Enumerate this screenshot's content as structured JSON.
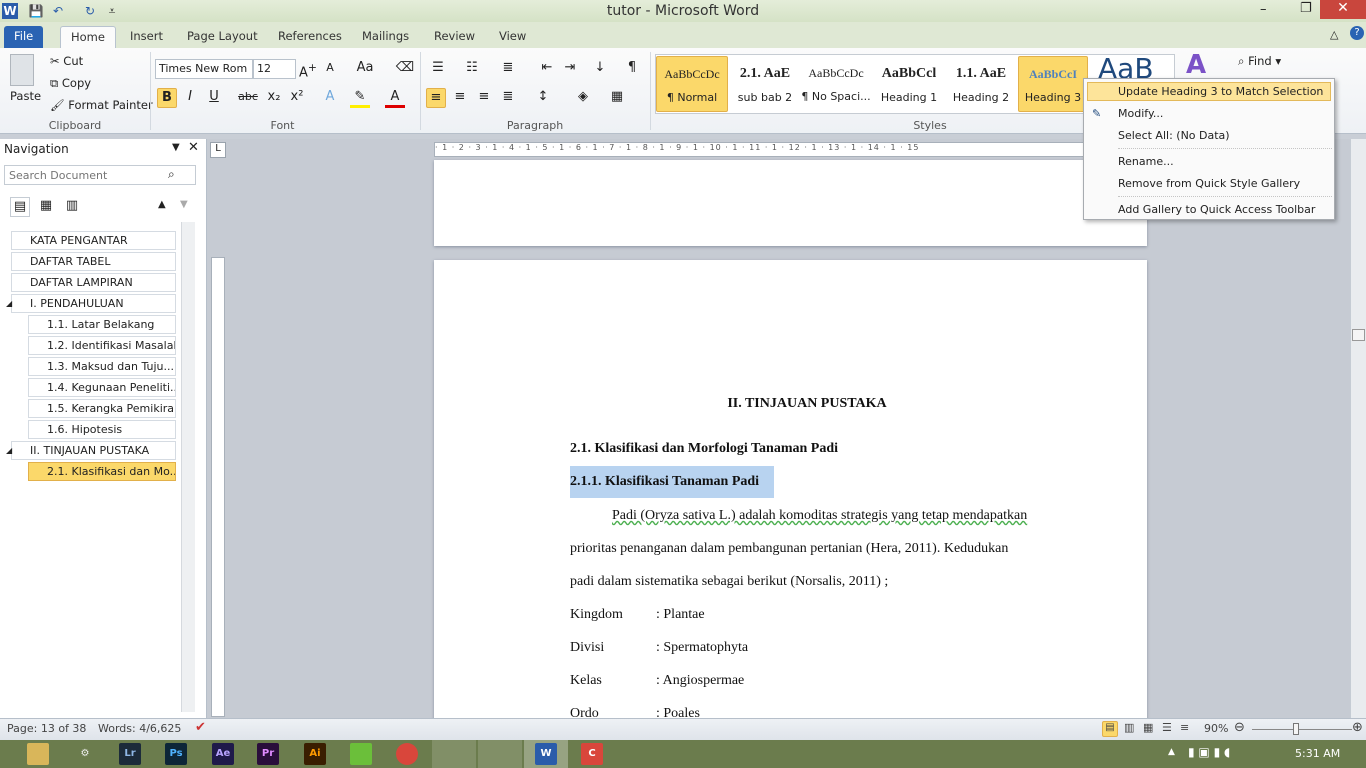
{
  "window": {
    "title": "tutor - Microsoft Word"
  },
  "tabs": [
    "File",
    "Home",
    "Insert",
    "Page Layout",
    "References",
    "Mailings",
    "Review",
    "View"
  ],
  "clipboard": {
    "paste": "Paste",
    "cut": "Cut",
    "copy": "Copy",
    "format_painter": "Format Painter",
    "label": "Clipboard"
  },
  "font": {
    "name": "Times New Rom",
    "size": "12",
    "label": "Font"
  },
  "paragraph": {
    "label": "Paragraph"
  },
  "styles": {
    "label": "Styles",
    "items": [
      {
        "preview": "AaBbCcDc",
        "name": "¶ Normal"
      },
      {
        "preview": "2.1. AaE",
        "name": "sub bab 2"
      },
      {
        "preview": "AaBbCcDc",
        "name": "¶ No Spaci..."
      },
      {
        "preview": "AaBbCcl",
        "name": "Heading 1"
      },
      {
        "preview": "1.1. AaE",
        "name": "Heading 2"
      },
      {
        "preview": "AaBbCcI",
        "name": "Heading 3"
      }
    ],
    "big_preview": "AaB"
  },
  "editing": {
    "find": "Find"
  },
  "context_menu": [
    "Update Heading 3 to Match Selection",
    "Modify...",
    "Select All: (No Data)",
    "Rename...",
    "Remove from Quick Style Gallery",
    "Add Gallery to Quick Access Toolbar"
  ],
  "navigation": {
    "title": "Navigation",
    "search_placeholder": "Search Document",
    "items": [
      {
        "label": "KATA PENGANTAR",
        "level": 1
      },
      {
        "label": "DAFTAR TABEL",
        "level": 1
      },
      {
        "label": "DAFTAR LAMPIRAN",
        "level": 1
      },
      {
        "label": "I. PENDAHULUAN",
        "level": 1
      },
      {
        "label": "1.1.  Latar Belakang",
        "level": 2
      },
      {
        "label": "1.2.  Identifikasi Masalah",
        "level": 2
      },
      {
        "label": "1.3.  Maksud dan Tuju...",
        "level": 2
      },
      {
        "label": "1.4.  Kegunaan Peneliti...",
        "level": 2
      },
      {
        "label": "1.5.  Kerangka Pemikiran",
        "level": 2
      },
      {
        "label": "1.6.  Hipotesis",
        "level": 2
      },
      {
        "label": "II. TINJAUAN PUSTAKA",
        "level": 1
      },
      {
        "label": "2.1.  Klasifikasi dan Mo...",
        "level": 2,
        "selected": true
      }
    ]
  },
  "document": {
    "chapter": "II. TINJAUAN  PUSTAKA",
    "h2": "2.1.  Klasifikasi dan Morfologi Tanaman  Padi",
    "h3": "2.1.1. Klasifikasi Tanaman  Padi",
    "para": [
      "Padi  (Oryza  sativa  L.)  adalah  komoditas  strategis  yang  tetap  mendapatkan",
      "prioritas  penanganan  dalam  pembangunan  pertanian  (Hera,  2011).  Kedudukan",
      "padi dalam  sistematika  sebagai  berikut (Norsalis,  2011) ;"
    ],
    "taxonomy": [
      {
        "k": "Kingdom",
        "v": ": Plantae"
      },
      {
        "k": "Divisi",
        "v": ": Spermatophyta"
      },
      {
        "k": "Kelas",
        "v": ": Angiospermae"
      },
      {
        "k": "Ordo",
        "v": ": Poales"
      }
    ]
  },
  "status": {
    "page": "Page: 13 of 38",
    "words": "Words: 4/6,625",
    "zoom": "90%",
    "zoom_percent": 90
  },
  "taskbar": {
    "apps": [
      "Lr",
      "Ps",
      "Ae",
      "Pr",
      "Ai"
    ],
    "clock": "5:31 AM"
  },
  "colors": {
    "accent": "#2a63b3",
    "highlight": "#fbd86a",
    "selection": "#b8d3f0"
  }
}
